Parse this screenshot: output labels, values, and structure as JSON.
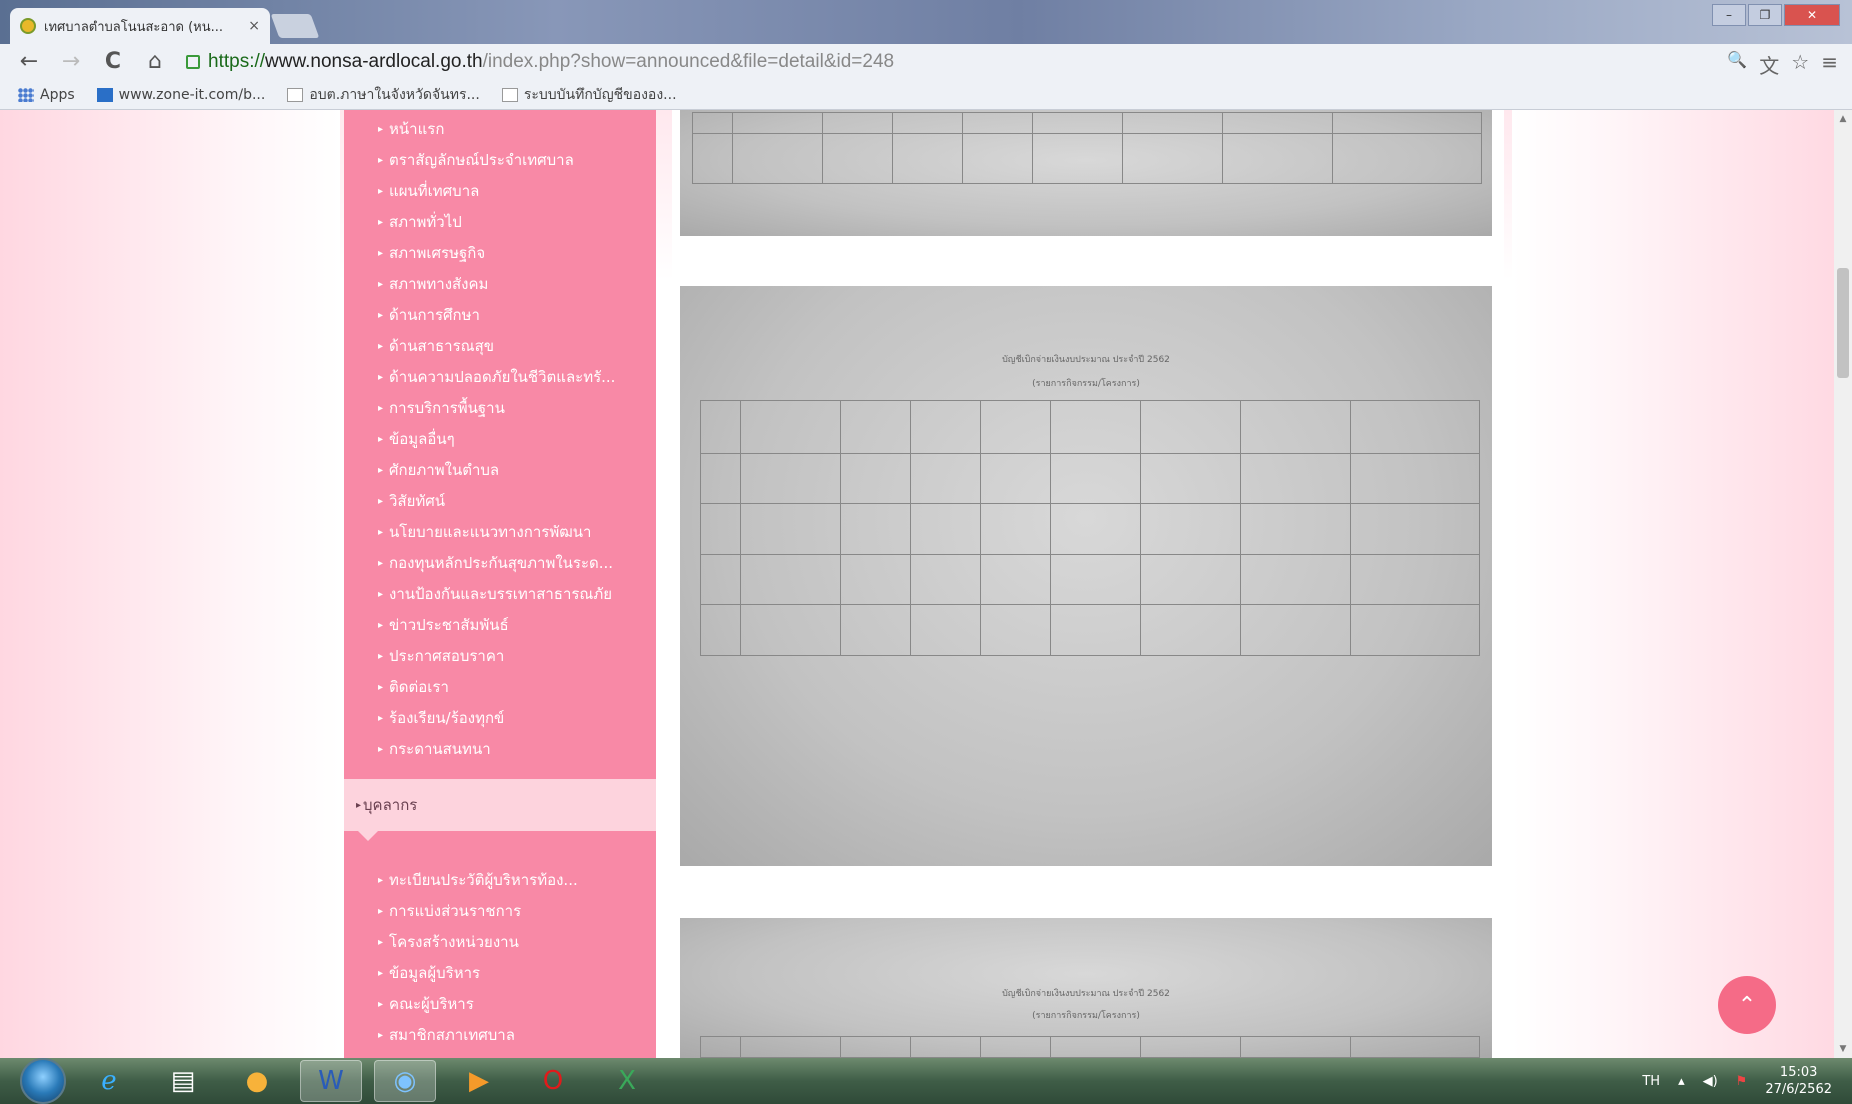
{
  "browser": {
    "tab_title": "เทศบาลตำบลโนนสะอาด (หน...",
    "tab_close": "×",
    "back": "←",
    "forward": "→",
    "reload": "C",
    "home": "⌂",
    "url_scheme": "https://",
    "url_host": "www.nonsa-ardlocal.go.th",
    "url_path": "/index.php?show=announced&file=detail&id=248",
    "zoom_icon": "🔍",
    "translate_icon": "文",
    "star_icon": "☆",
    "menu_icon": "≡",
    "window_controls": {
      "minimize": "–",
      "restore": "❐",
      "close": "✕"
    },
    "bookmarks": [
      {
        "label": "Apps",
        "icon": "apps-grid-icon"
      },
      {
        "label": "www.zone-it.com/b...",
        "icon": "zone-it-icon"
      },
      {
        "label": "อบต.ภาษาในจังหวัดจันทร...",
        "icon": "page-icon"
      },
      {
        "label": "ระบบบันทึกบัญชีขององ...",
        "icon": "page-icon"
      }
    ]
  },
  "sidebar": {
    "bullet": "▸",
    "menu_main": [
      "หน้าแรก",
      "ตราสัญลักษณ์ประจำเทศบาล",
      "แผนที่เทศบาล",
      "สภาพทั่วไป",
      "สภาพเศรษฐกิจ",
      "สภาพทางสังคม",
      "ด้านการศึกษา",
      "ด้านสาธารณสุข",
      "ด้านความปลอดภัยในชีวิตและทรั...",
      "การบริการพื้นฐาน",
      "ข้อมูลอื่นๆ",
      "ศักยภาพในตำบล",
      "วิสัยทัศน์",
      "นโยบายและแนวทางการพัฒนา",
      "กองทุนหลักประกันสุขภาพในระด...",
      "งานป้องกันและบรรเทาสาธารณภัย",
      "ข่าวประชาสัมพันธ์",
      "ประกาศสอบราคา",
      "ติดต่อเรา",
      "ร้องเรียน/ร้องทุกข์",
      "กระดานสนทนา"
    ],
    "section_title": "บุคลากร",
    "menu_staff": [
      "ทะเบียนประวัติผู้บริหารท้อง...",
      "การแบ่งส่วนราชการ",
      "โครงสร้างหน่วยงาน",
      "ข้อมูลผู้บริหาร",
      "คณะผู้บริหาร",
      "สมาชิกสภาเทศบาล"
    ]
  },
  "content": {
    "doc2_title": "บัญชีเบิกจ่ายเงินงบประมาณ ประจำปี 2562",
    "doc2_subtitle": "(รายการกิจกรรม/โครงการ)",
    "doc3_title": "บัญชีเบิกจ่ายเงินงบประมาณ ประจำปี 2562",
    "doc3_subtitle": "(รายการกิจกรรม/โครงการ)"
  },
  "back_to_top": "⌃",
  "taskbar": {
    "apps": [
      "ie-icon",
      "file-explorer-icon",
      "paint-icon",
      "word-icon",
      "chrome-icon",
      "media-player-icon",
      "opera-icon",
      "excel-icon"
    ],
    "lang": "TH",
    "time": "15:03",
    "date": "27/6/2562"
  }
}
